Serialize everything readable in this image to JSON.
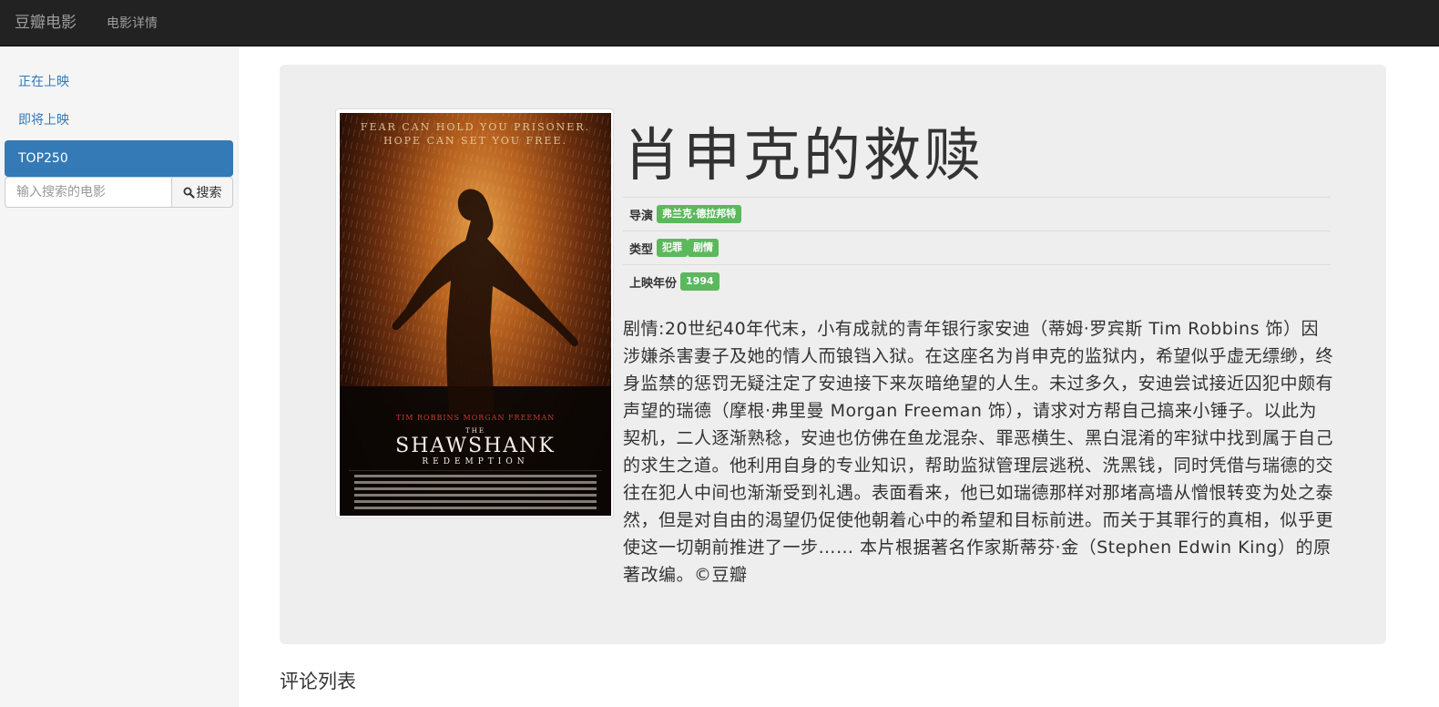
{
  "navbar": {
    "brand": "豆瓣电影",
    "link": "电影详情"
  },
  "sidebar": {
    "items": [
      {
        "label": "正在上映",
        "active": false
      },
      {
        "label": "即将上映",
        "active": false
      },
      {
        "label": "TOP250",
        "active": true
      }
    ],
    "search": {
      "placeholder": "输入搜索的电影",
      "button_label": "搜索",
      "button_icon": "search-icon"
    }
  },
  "movie": {
    "title": "肖申克的救赎",
    "poster": {
      "tagline_line1": "FEAR CAN HOLD YOU PRISONER.",
      "tagline_line2": "HOPE CAN SET YOU FREE.",
      "actors": "TIM ROBBINS    MORGAN FREEMAN",
      "title_the": "THE",
      "title_main": "SHAWSHANK",
      "title_sub": "REDEMPTION"
    },
    "director_label": "导演",
    "director": "弗兰克·德拉邦特",
    "genre_label": "类型",
    "genres": [
      "犯罪",
      "剧情"
    ],
    "year_label": "上映年份",
    "year": "1994",
    "synopsis": "剧情:20世纪40年代末，小有成就的青年银行家安迪（蒂姆·罗宾斯 Tim Robbins 饰）因涉嫌杀害妻子及她的情人而锒铛入狱。在这座名为肖申克的监狱内，希望似乎虚无缥缈，终身监禁的惩罚无疑注定了安迪接下来灰暗绝望的人生。未过多久，安迪尝试接近囚犯中颇有声望的瑞德（摩根·弗里曼 Morgan Freeman 饰），请求对方帮自己搞来小锤子。以此为契机，二人逐渐熟稔，安迪也仿佛在鱼龙混杂、罪恶横生、黑白混淆的牢狱中找到属于自己的求生之道。他利用自身的专业知识，帮助监狱管理层逃税、洗黑钱，同时凭借与瑞德的交往在犯人中间也渐渐受到礼遇。表面看来，他已如瑞德那样对那堵高墙从憎恨转变为处之泰然，但是对自由的渴望仍促使他朝着心中的希望和目标前进。而关于其罪行的真相，似乎更使这一切朝前推进了一步…… 本片根据著名作家斯蒂芬·金（Stephen Edwin King）的原著改编。©豆瓣"
  },
  "comments": {
    "heading": "评论列表"
  },
  "colors": {
    "navbar_bg": "#222222",
    "accent": "#337ab7",
    "badge": "#5cb85c",
    "jumbotron_bg": "#eeeeee"
  }
}
